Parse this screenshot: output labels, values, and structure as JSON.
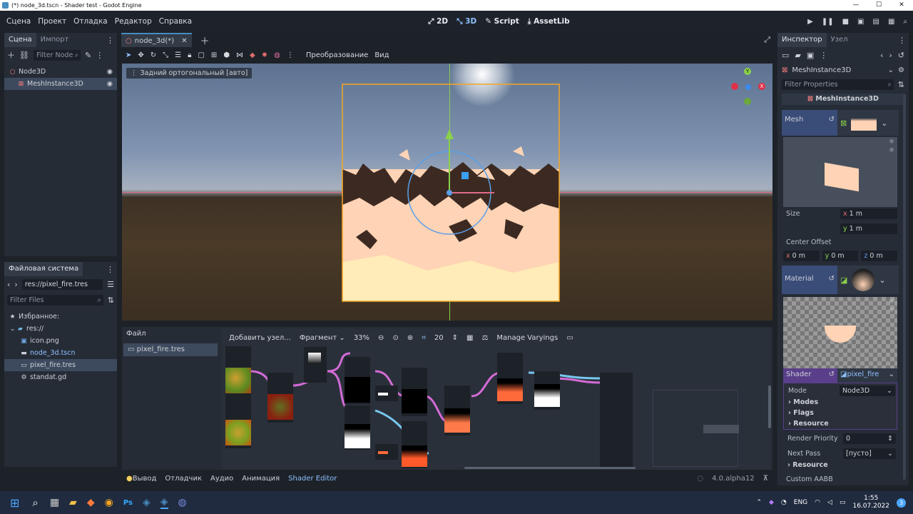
{
  "window": {
    "title": "(*) node_3d.tscn - Shader test - Godot Engine"
  },
  "menu": [
    "Сцена",
    "Проект",
    "Отладка",
    "Редактор",
    "Справка"
  ],
  "modes": [
    "2D",
    "3D",
    "Script",
    "AssetLib"
  ],
  "scene_dock": {
    "tabs": [
      "Сцена",
      "Импорт"
    ],
    "filter_placeholder": "Filter Node",
    "nodes": [
      {
        "name": "Node3D",
        "icon": "node3d-icon"
      },
      {
        "name": "MeshInstance3D",
        "icon": "mesh-instance-icon"
      }
    ]
  },
  "filesystem": {
    "title": "Файловая система",
    "path": "res://pixel_fire.tres",
    "filter_placeholder": "Filter Files",
    "items": [
      {
        "label": "Избранное:",
        "icon": "star-icon"
      },
      {
        "label": "res://",
        "icon": "folder-icon"
      },
      {
        "label": "icon.png",
        "icon": "image-icon"
      },
      {
        "label": "node_3d.tscn",
        "icon": "scene-icon"
      },
      {
        "label": "pixel_fire.tres",
        "icon": "resource-icon"
      },
      {
        "label": "standat.gd",
        "icon": "gear-icon"
      }
    ]
  },
  "editor_tab": {
    "label": "node_3d(*)"
  },
  "viewport": {
    "toolbar": {
      "transform": "Преобразование",
      "view": "Вид"
    },
    "perspective_label": "Задний ортогональный [авто]"
  },
  "shader_editor": {
    "file_menu": "Файл",
    "file": "pixel_fire.tres",
    "add_node": "Добавить узел...",
    "mode": "Фрагмент",
    "zoom": "33%",
    "snap": "20",
    "varyings": "Manage Varyings"
  },
  "bottom_tabs": [
    "Вывод",
    "Отладчик",
    "Аудио",
    "Анимация",
    "Shader Editor"
  ],
  "version": "4.0.alpha12",
  "inspector": {
    "tabs": [
      "Инспектор",
      "Узел"
    ],
    "object": "MeshInstance3D",
    "filter_placeholder": "Filter Properties",
    "section": "MeshInstance3D",
    "mesh_label": "Mesh",
    "size_label": "Size",
    "size_x": "1",
    "size_y": "1",
    "unit": "m",
    "center_offset_label": "Center Offset",
    "offset": {
      "x": "0",
      "y": "0",
      "z": "0"
    },
    "material_label": "Material",
    "shader_label": "Shader",
    "shader_value": "pixel_fire",
    "mode_label": "Mode",
    "mode_value": "Node3D",
    "modes_group": "Modes",
    "flags_group": "Flags",
    "resource_group": "Resource",
    "render_priority_label": "Render Priority",
    "render_priority": "0",
    "next_pass_label": "Next Pass",
    "next_pass": "[пусто]",
    "resource2": "Resource",
    "custom_aabb": "Custom AABB"
  },
  "taskbar": {
    "lang": "ENG",
    "time": "1:55",
    "date": "16.07.2022",
    "badge": "3"
  },
  "colors": {
    "accent": "#478cbf",
    "fire": "#ffd3b5",
    "selection": "#f5a623"
  }
}
